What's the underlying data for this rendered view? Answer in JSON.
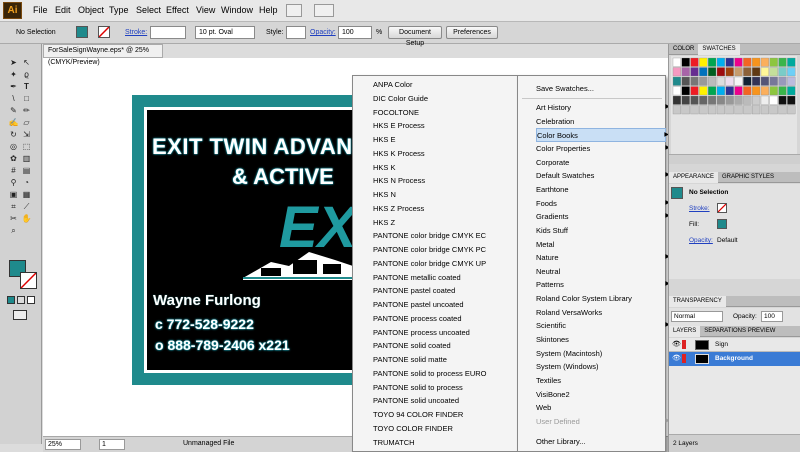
{
  "menubar": {
    "logo": "Ai",
    "items": [
      "File",
      "Edit",
      "Object",
      "Type",
      "Select",
      "Effect",
      "View",
      "Window",
      "Help"
    ]
  },
  "controlbar": {
    "selection": "No Selection",
    "stroke_label": "Stroke:",
    "brush": "10 pt. Oval",
    "style_label": "Style:",
    "opacity_label": "Opacity:",
    "opacity_value": "100",
    "percent": "%",
    "document_setup": "Document Setup",
    "preferences": "Preferences"
  },
  "document": {
    "tab_title": "ForSaleSignWayne.eps* @ 25% (CMYK/Preview)",
    "close": "×"
  },
  "sign": {
    "line1": "EXIT TWIN ADVAN",
    "line2": "& ACTIVE",
    "logo_text": "EX",
    "name": "Wayne Furlong",
    "cell": "c 772-528-9222",
    "office": "o 888-789-2406 x221"
  },
  "statusbar": {
    "zoom": "25%",
    "page": "1",
    "file_state": "Unmanaged File"
  },
  "swatch_menu": {
    "items": [
      {
        "label": "Save Swatches...",
        "arrow": false
      },
      {
        "label": "Art History",
        "arrow": true
      },
      {
        "label": "Celebration",
        "arrow": false
      },
      {
        "label": "Color Books",
        "arrow": true
      },
      {
        "label": "Color Properties",
        "arrow": true
      },
      {
        "label": "Corporate",
        "arrow": false
      },
      {
        "label": "Default Swatches",
        "arrow": true
      },
      {
        "label": "Earthtone",
        "arrow": false
      },
      {
        "label": "Foods",
        "arrow": true
      },
      {
        "label": "Gradients",
        "arrow": true
      },
      {
        "label": "Kids Stuff",
        "arrow": false
      },
      {
        "label": "Metal",
        "arrow": false
      },
      {
        "label": "Nature",
        "arrow": true
      },
      {
        "label": "Neutral",
        "arrow": false
      },
      {
        "label": "Patterns",
        "arrow": true
      },
      {
        "label": "Roland Color System Library",
        "arrow": false
      },
      {
        "label": "Roland VersaWorks",
        "arrow": false
      },
      {
        "label": "Scientific",
        "arrow": true
      },
      {
        "label": "Skintones",
        "arrow": false
      },
      {
        "label": "System (Macintosh)",
        "arrow": false
      },
      {
        "label": "System (Windows)",
        "arrow": false
      },
      {
        "label": "Textiles",
        "arrow": false
      },
      {
        "label": "VisiBone2",
        "arrow": false
      },
      {
        "label": "Web",
        "arrow": false
      },
      {
        "label": "User Defined",
        "arrow": true,
        "disabled": true
      },
      {
        "label": "Other Library...",
        "arrow": false
      }
    ],
    "highlighted": "Color Books"
  },
  "color_books_menu": {
    "items": [
      "ANPA Color",
      "DIC Color Guide",
      "FOCOLTONE",
      "HKS E Process",
      "HKS E",
      "HKS K Process",
      "HKS K",
      "HKS N Process",
      "HKS N",
      "HKS Z Process",
      "HKS Z",
      "PANTONE color bridge CMYK EC",
      "PANTONE color bridge CMYK PC",
      "PANTONE color bridge CMYK UP",
      "PANTONE metallic coated",
      "PANTONE pastel coated",
      "PANTONE pastel uncoated",
      "PANTONE process coated",
      "PANTONE process uncoated",
      "PANTONE solid coated",
      "PANTONE solid matte",
      "PANTONE solid to process EURO",
      "PANTONE solid to process",
      "PANTONE solid uncoated",
      "TOYO 94 COLOR FINDER",
      "TOYO COLOR FINDER",
      "TRUMATCH"
    ]
  },
  "panels": {
    "swatch_tabs": [
      "COLOR",
      "SWATCHES"
    ],
    "appearance_tabs": [
      "APPEARANCE",
      "GRAPHIC STYLES"
    ],
    "appearance": {
      "selection": "No Selection",
      "stroke": "Stroke:",
      "fill": "Fill:",
      "opacity": "Opacity:",
      "opacity_value": "Default"
    },
    "transparency_tab": "TRANSPARENCY",
    "transparency": {
      "mode": "Normal",
      "opacity_label": "Opacity:",
      "opacity_value": "100"
    },
    "layers_tabs": [
      "LAYERS",
      "SEPARATIONS PREVIEW"
    ],
    "layers": [
      {
        "name": "Sign",
        "selected": false
      },
      {
        "name": "Background",
        "selected": true
      }
    ],
    "layer_count": "2 Layers"
  },
  "colors": {
    "teal": "#1f8a8c",
    "highlight": "#c9dff5",
    "selected_layer": "#3a7bd5"
  }
}
